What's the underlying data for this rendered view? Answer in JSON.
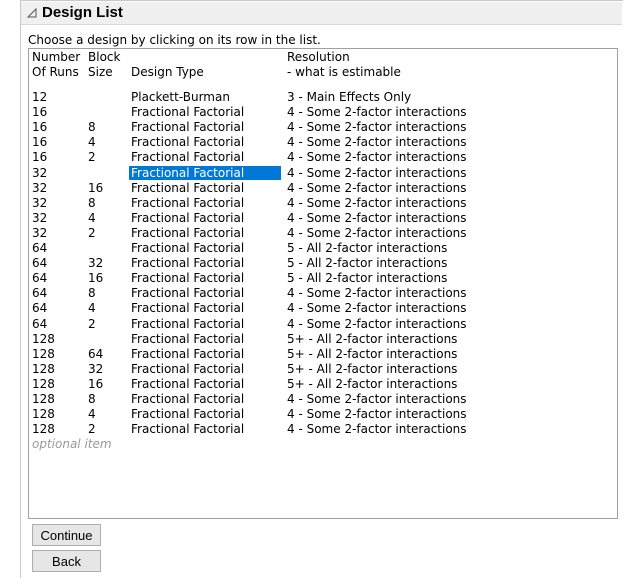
{
  "outline": {
    "title": "Design List"
  },
  "instruction": "Choose a design by clicking on its row in the list.",
  "columns": {
    "runs": [
      "Number",
      "Of Runs"
    ],
    "block": [
      "Block",
      "Size"
    ],
    "type": [
      "",
      "Design Type"
    ],
    "resolution": [
      "Resolution",
      " - what is estimable"
    ]
  },
  "rows": [
    [
      "12",
      "",
      "Plackett-Burman",
      "3 - Main Effects Only"
    ],
    [
      "16",
      "",
      "Fractional Factorial",
      "4 - Some 2-factor interactions"
    ],
    [
      "16",
      "8",
      "Fractional Factorial",
      "4 - Some 2-factor interactions"
    ],
    [
      "16",
      "4",
      "Fractional Factorial",
      "4 - Some 2-factor interactions"
    ],
    [
      "16",
      "2",
      "Fractional Factorial",
      "4 - Some 2-factor interactions"
    ],
    [
      "32",
      "",
      "Fractional Factorial",
      "4 - Some 2-factor interactions"
    ],
    [
      "32",
      "16",
      "Fractional Factorial",
      "4 - Some 2-factor interactions"
    ],
    [
      "32",
      "8",
      "Fractional Factorial",
      "4 - Some 2-factor interactions"
    ],
    [
      "32",
      "4",
      "Fractional Factorial",
      "4 - Some 2-factor interactions"
    ],
    [
      "32",
      "2",
      "Fractional Factorial",
      "4 - Some 2-factor interactions"
    ],
    [
      "64",
      "",
      "Fractional Factorial",
      "5 - All 2-factor interactions"
    ],
    [
      "64",
      "32",
      "Fractional Factorial",
      "5 - All 2-factor interactions"
    ],
    [
      "64",
      "16",
      "Fractional Factorial",
      "5 - All 2-factor interactions"
    ],
    [
      "64",
      "8",
      "Fractional Factorial",
      "4 - Some 2-factor interactions"
    ],
    [
      "64",
      "4",
      "Fractional Factorial",
      "4 - Some 2-factor interactions"
    ],
    [
      "64",
      "2",
      "Fractional Factorial",
      "4 - Some 2-factor interactions"
    ],
    [
      "128",
      "",
      "Fractional Factorial",
      "5+ - All 2-factor interactions"
    ],
    [
      "128",
      "64",
      "Fractional Factorial",
      "5+ - All 2-factor interactions"
    ],
    [
      "128",
      "32",
      "Fractional Factorial",
      "5+ - All 2-factor interactions"
    ],
    [
      "128",
      "16",
      "Fractional Factorial",
      "5+ - All 2-factor interactions"
    ],
    [
      "128",
      "8",
      "Fractional Factorial",
      "4 - Some 2-factor interactions"
    ],
    [
      "128",
      "4",
      "Fractional Factorial",
      "4 - Some 2-factor interactions"
    ],
    [
      "128",
      "2",
      "Fractional Factorial",
      "4 - Some 2-factor interactions"
    ]
  ],
  "selected_row": 5,
  "optional_item": "optional item",
  "buttons": {
    "continue": "Continue",
    "back": "Back"
  },
  "colors": {
    "selection": "#0078d7",
    "header_bg": "#f0f0f0"
  },
  "icons": {
    "disclosure": "disclosure-triangle-icon"
  }
}
